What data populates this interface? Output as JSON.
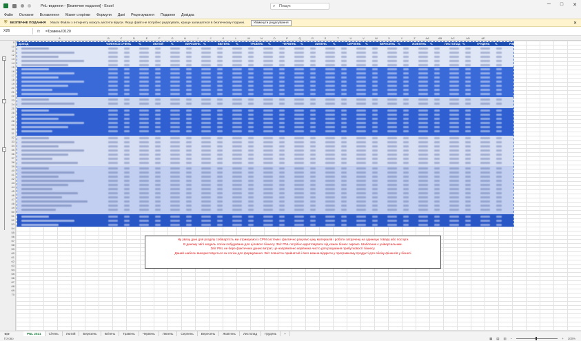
{
  "window": {
    "title": "PnL-ведення - [Безпечне подання] - Excel",
    "search_placeholder": "Пошук",
    "min_label": "─",
    "max_label": "□",
    "close_label": "✕"
  },
  "colors": {
    "accent": "#1a7a3a",
    "blue_fill": "#2f5fd0",
    "blue_dark": "#1f4fb0",
    "note_text": "#dd1111"
  },
  "menu": [
    "Файл",
    "Основне",
    "Вставлення",
    "Макет сторінки",
    "Формули",
    "Дані",
    "Рецензування",
    "Подання",
    "Довідка"
  ],
  "message_bar": {
    "title": "БЕЗПЕЧНЕ ПОДАННЯ",
    "text": "Увага! Файли з Інтернету можуть містити віруси. Якщо файл не потрібно редагувати, краще залишатися в безпечному поданні.",
    "button": "Увімкнути редагування"
  },
  "formula_bar": {
    "name_box": "X26",
    "fx": "fx",
    "value": "=Травень!D120"
  },
  "columns": [
    "A",
    "B",
    "C",
    "D",
    "E",
    "F",
    "G",
    "H",
    "I",
    "J",
    "K",
    "L",
    "M",
    "N",
    "O",
    "P",
    "Q",
    "R",
    "S",
    "T",
    "U",
    "V",
    "W",
    "X",
    "Y",
    "Z",
    "AA",
    "AB",
    "AC",
    "AD",
    "AE"
  ],
  "header_row": [
    "ДОХОД",
    "%ФЕНХО2",
    "СІЧЕНЬ",
    "%",
    "ЛЮТИЙ",
    "%",
    "БЕРЕЗЕНЬ",
    "%",
    "КВІТЕНЬ",
    "%",
    "ТРАВЕНЬ",
    "%",
    "ЧЕРВЕНЬ",
    "%",
    "ЛИПЕНЬ",
    "%",
    "СЕРПЕНЬ",
    "%",
    "ВЕРЕСЕНЬ",
    "%",
    "ЖОВТЕНЬ",
    "%",
    "ЛИСТОПАД",
    "%",
    "ГРУДЕНЬ",
    "%",
    "РІК",
    "%"
  ],
  "row_numbers": [
    "9",
    "10",
    "11",
    "12",
    "13",
    "14",
    "15",
    "16",
    "17",
    "18",
    "19",
    "20",
    "21",
    "22",
    "23",
    "24",
    "25",
    "26",
    "27",
    "28",
    "29",
    "30",
    "31",
    "32",
    "33",
    "34",
    "35",
    "36",
    "37",
    "38",
    "39",
    "40",
    "41",
    "42",
    "43",
    "44",
    "45",
    "46",
    "47",
    "48",
    "49",
    "50",
    "51",
    "52",
    "53",
    "54",
    "55",
    "56",
    "57",
    "58",
    "59",
    "60",
    "61",
    "62",
    "63",
    "64",
    "65",
    "66",
    "67",
    "68",
    "69",
    "70"
  ],
  "note_lines": [
    "Ну увазу дані для розділу собівартість ми отримуємо із CPM системи і фактично рахуємо ціну матеріалів і роботи затрачену на одиницю товару або послуги",
    "В даному звіті модель логіки побудована для цілового бізнесу. Звіт PNL потрібно адаптовувати під кожен бізнес окремо. Шаблонне є універсальним.",
    "Звіт PNL не бере фактичних даних витрат, це напрямлено керівника чисто для розуміння прибутковості бізнесу.",
    "Даний шаблон використовується як логіка для формування. Звіт повністю прийнятий і його можна відкрити у програмному продукті для обліку фінансів у бізнесі"
  ],
  "sheet_tabs": [
    "PNL 2021",
    "Січень",
    "Лютий",
    "Березень",
    "Квітень",
    "Травень",
    "Червень",
    "Липень",
    "Серпень",
    "Вересень",
    "Жовтень",
    "Листопад",
    "Грудень",
    "+"
  ],
  "active_tab": "PNL 2021",
  "status": {
    "left": "Готово",
    "zoom": "100%"
  }
}
